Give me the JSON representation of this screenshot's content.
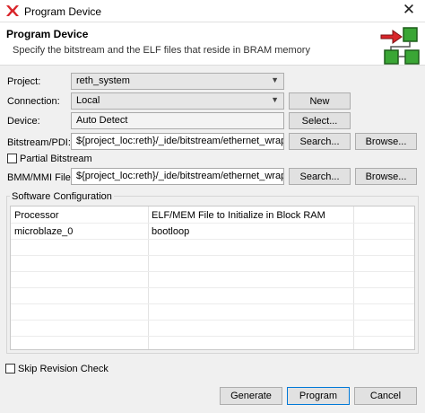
{
  "window": {
    "title": "Program Device",
    "close_glyph": "✕"
  },
  "banner": {
    "title": "Program Device",
    "subtitle": "Specify the bitstream and the ELF files that reside in BRAM memory"
  },
  "form": {
    "project_label": "Project:",
    "project_value": "reth_system",
    "connection_label": "Connection:",
    "connection_value": "Local",
    "new_button": "New",
    "device_label": "Device:",
    "device_value": "Auto Detect",
    "select_button": "Select...",
    "bitstream_label": "Bitstream/PDI:",
    "bitstream_value": "${project_loc:reth}/_ide/bitstream/ethernet_wrapper.bit",
    "bitstream_search": "Search...",
    "bitstream_browse": "Browse...",
    "partial_label": "Partial Bitstream",
    "partial_checked": false,
    "bmm_label": "BMM/MMI File:",
    "bmm_value": "${project_loc:reth}/_ide/bitstream/ethernet_wrapper.mmi",
    "bmm_search": "Search...",
    "bmm_browse": "Browse..."
  },
  "software": {
    "group_title": "Software Configuration",
    "columns": [
      "Processor",
      "ELF/MEM File to Initialize in Block RAM"
    ],
    "rows": [
      [
        "microblaze_0",
        "bootloop"
      ]
    ]
  },
  "footer": {
    "skip_label": "Skip Revision Check",
    "skip_checked": false,
    "generate": "Generate",
    "program": "Program",
    "cancel": "Cancel"
  },
  "icons": {
    "app": "xilinx-logo-icon",
    "banner": "program-device-icon",
    "dropdown": "chevron-down-icon"
  },
  "colors": {
    "accent_red": "#d9252a",
    "chip_green": "#3aa635",
    "focus_blue": "#0078d7"
  }
}
